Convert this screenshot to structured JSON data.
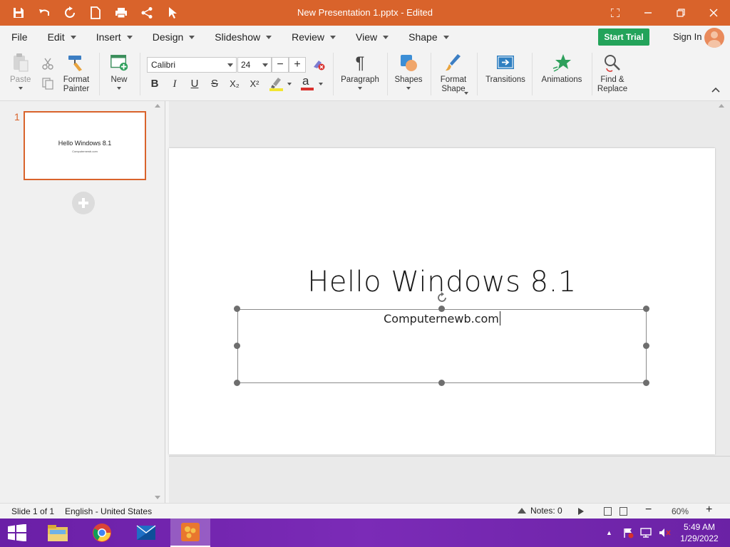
{
  "window": {
    "title": "New Presentation 1.pptx - Edited"
  },
  "quick_access": [
    "save-icon",
    "undo-icon",
    "redo-icon",
    "new-file-icon",
    "print-icon",
    "share-icon",
    "cursor-icon"
  ],
  "menu": {
    "items": [
      {
        "label": "File",
        "has_caret": false
      },
      {
        "label": "Edit",
        "has_caret": true
      },
      {
        "label": "Insert",
        "has_caret": true
      },
      {
        "label": "Design",
        "has_caret": true
      },
      {
        "label": "Slideshow",
        "has_caret": true
      },
      {
        "label": "Review",
        "has_caret": true
      },
      {
        "label": "View",
        "has_caret": true
      },
      {
        "label": "Shape",
        "has_caret": true
      }
    ],
    "start_trial": "Start Trial",
    "sign_in": "Sign In"
  },
  "ribbon": {
    "paste": "Paste",
    "format_painter": "Format\nPainter",
    "new": "New",
    "font_name": "Calibri",
    "font_size": "24",
    "bold": "B",
    "italic": "I",
    "underline": "U",
    "strike": "S",
    "subscript": "X₂",
    "superscript": "X²",
    "paragraph": "Paragraph",
    "shapes": "Shapes",
    "format_shape": "Format\nShape",
    "transitions": "Transitions",
    "animations": "Animations",
    "find_replace": "Find &\nReplace"
  },
  "slides_panel": {
    "slide_number": "1",
    "thumb_title": "Hello Windows 8.1",
    "thumb_subtitle": "Computernewb.com"
  },
  "slide": {
    "title": "Hello Windows 8.1",
    "subtitle": "Computernewb.com"
  },
  "status": {
    "slide_info": "Slide 1 of 1",
    "language": "English - United States",
    "notes": "Notes: 0",
    "zoom": "60%"
  },
  "taskbar": {
    "time": "5:49 AM",
    "date": "1/29/2022"
  },
  "colors": {
    "accent": "#d9632b",
    "start_trial": "#23a35a",
    "taskbar": "#7b2bb7"
  }
}
